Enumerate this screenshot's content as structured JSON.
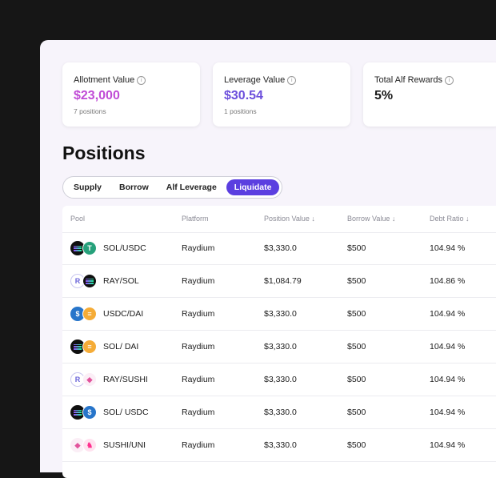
{
  "cards": [
    {
      "label": "Allotment Value",
      "value": "$23,000",
      "sub": "7 positions",
      "info_icon": "info-icon"
    },
    {
      "label": "Leverage Value",
      "value": "$30.54",
      "sub": "1 positions",
      "info_icon": "info-icon"
    },
    {
      "label": "Total Alf Rewards",
      "value": "5%",
      "sub": "",
      "info_icon": "info-icon"
    }
  ],
  "page_title": "Positions",
  "tabs": [
    {
      "label": "Supply",
      "active": false
    },
    {
      "label": "Borrow",
      "active": false
    },
    {
      "label": "Alf Leverage",
      "active": false
    },
    {
      "label": "Liquidate",
      "active": true
    }
  ],
  "table": {
    "headers": {
      "pool": "Pool",
      "platform": "Platform",
      "position_value": "Position Value ↓",
      "borrow_value": "Borrow Value ↓",
      "debt_ratio": "Debt Ratio ↓"
    },
    "rows": [
      {
        "pool": "SOL/USDC",
        "icons": [
          "sol-icon",
          "usdt-icon"
        ],
        "platform": "Raydium",
        "position_value": "$3,330.0",
        "borrow_value": "$500",
        "debt_ratio": "104.94 %"
      },
      {
        "pool": "RAY/SOL",
        "icons": [
          "ray-icon",
          "sol-icon"
        ],
        "platform": "Raydium",
        "position_value": "$1,084.79",
        "borrow_value": "$500",
        "debt_ratio": "104.86 %"
      },
      {
        "pool": "USDC/DAI",
        "icons": [
          "usdc-icon",
          "dai-icon"
        ],
        "platform": "Raydium",
        "position_value": "$3,330.0",
        "borrow_value": "$500",
        "debt_ratio": "104.94 %"
      },
      {
        "pool": "SOL/ DAI",
        "icons": [
          "sol-icon",
          "dai-icon"
        ],
        "platform": "Raydium",
        "position_value": "$3,330.0",
        "borrow_value": "$500",
        "debt_ratio": "104.94 %"
      },
      {
        "pool": "RAY/SUSHI",
        "icons": [
          "ray-icon",
          "sushi-icon"
        ],
        "platform": "Raydium",
        "position_value": "$3,330.0",
        "borrow_value": "$500",
        "debt_ratio": "104.94 %"
      },
      {
        "pool": "SOL/ USDC",
        "icons": [
          "sol-icon",
          "usdc-icon"
        ],
        "platform": "Raydium",
        "position_value": "$3,330.0",
        "borrow_value": "$500",
        "debt_ratio": "104.94 %"
      },
      {
        "pool": "SUSHI/UNI",
        "icons": [
          "sushi-icon",
          "uni-icon"
        ],
        "platform": "Raydium",
        "position_value": "$3,330.0",
        "borrow_value": "$500",
        "debt_ratio": "104.94 %"
      }
    ]
  },
  "colors": {
    "accent": "#5b3fe0",
    "allotment_value": "#c04cd6",
    "leverage_value": "#6c4fdc",
    "background": "#161616",
    "panel": "#f7f4fb"
  }
}
